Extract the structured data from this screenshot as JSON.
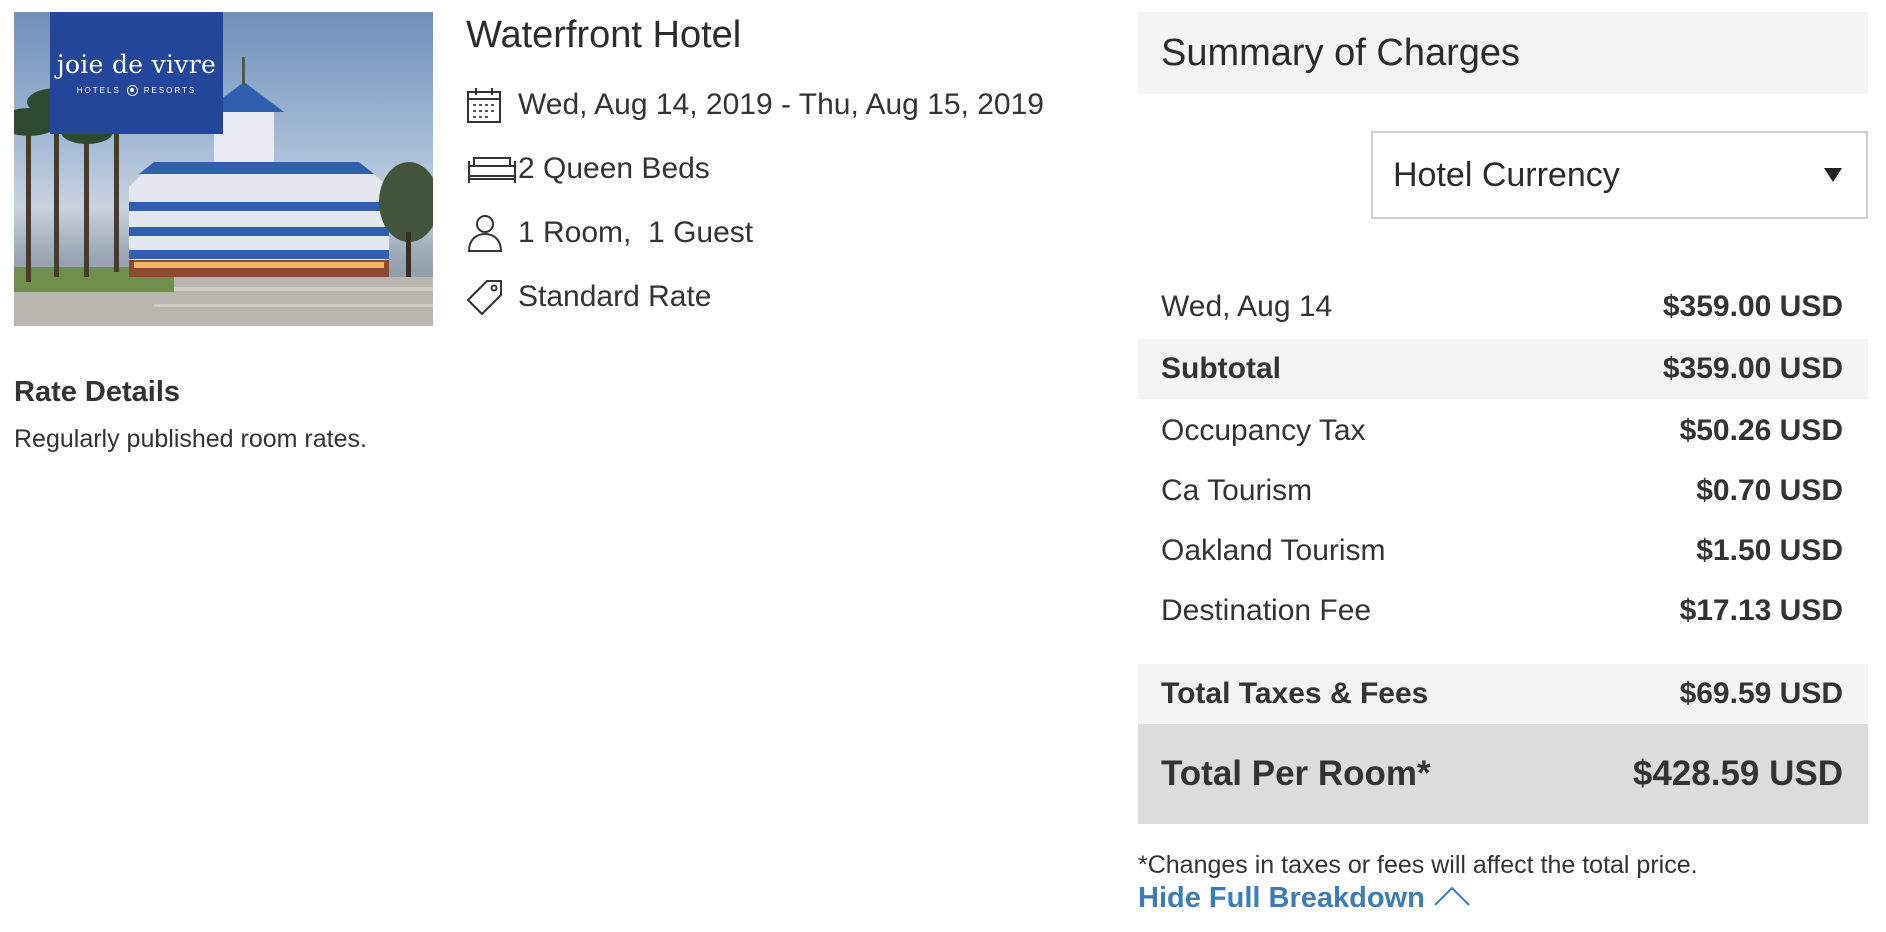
{
  "hotel": {
    "name": "Waterfront Hotel",
    "logo": {
      "main": "joie de vivre",
      "sub_left": "HOTELS",
      "sub_right": "RESORTS"
    },
    "details": [
      {
        "icon": "calendar-icon",
        "text": "Wed, Aug 14, 2019 - Thu, Aug 15, 2019"
      },
      {
        "icon": "bed-icon",
        "text": "2 Queen Beds"
      },
      {
        "icon": "person-icon",
        "text": "1 Room,  1 Guest"
      },
      {
        "icon": "tag-icon",
        "text": "Standard Rate"
      }
    ]
  },
  "rate_details": {
    "title": "Rate Details",
    "description": "Regularly published room rates."
  },
  "summary": {
    "title": "Summary of Charges",
    "currency_select": {
      "selected": "Hotel Currency"
    },
    "nightly": [
      {
        "label": "Wed, Aug 14",
        "amount": "$359.00 USD"
      }
    ],
    "subtotal": {
      "label": "Subtotal",
      "amount": "$359.00 USD"
    },
    "taxes": [
      {
        "label": "Occupancy Tax",
        "amount": "$50.26 USD"
      },
      {
        "label": "Ca Tourism",
        "amount": "$0.70 USD"
      },
      {
        "label": "Oakland Tourism",
        "amount": "$1.50 USD"
      },
      {
        "label": "Destination Fee",
        "amount": "$17.13 USD"
      }
    ],
    "total_taxes": {
      "label": "Total Taxes & Fees",
      "amount": "$69.59 USD"
    },
    "total_per_room": {
      "label": "Total Per Room*",
      "amount": "$428.59 USD"
    },
    "footnote": "*Changes in taxes or fees will affect the total price.",
    "breakdown_link": "Hide Full Breakdown"
  },
  "colors": {
    "link": "#3f7cb6",
    "logo_bg": "#23469a",
    "shaded_row": "#f4f4f4",
    "total_row": "#dcdcdc"
  }
}
